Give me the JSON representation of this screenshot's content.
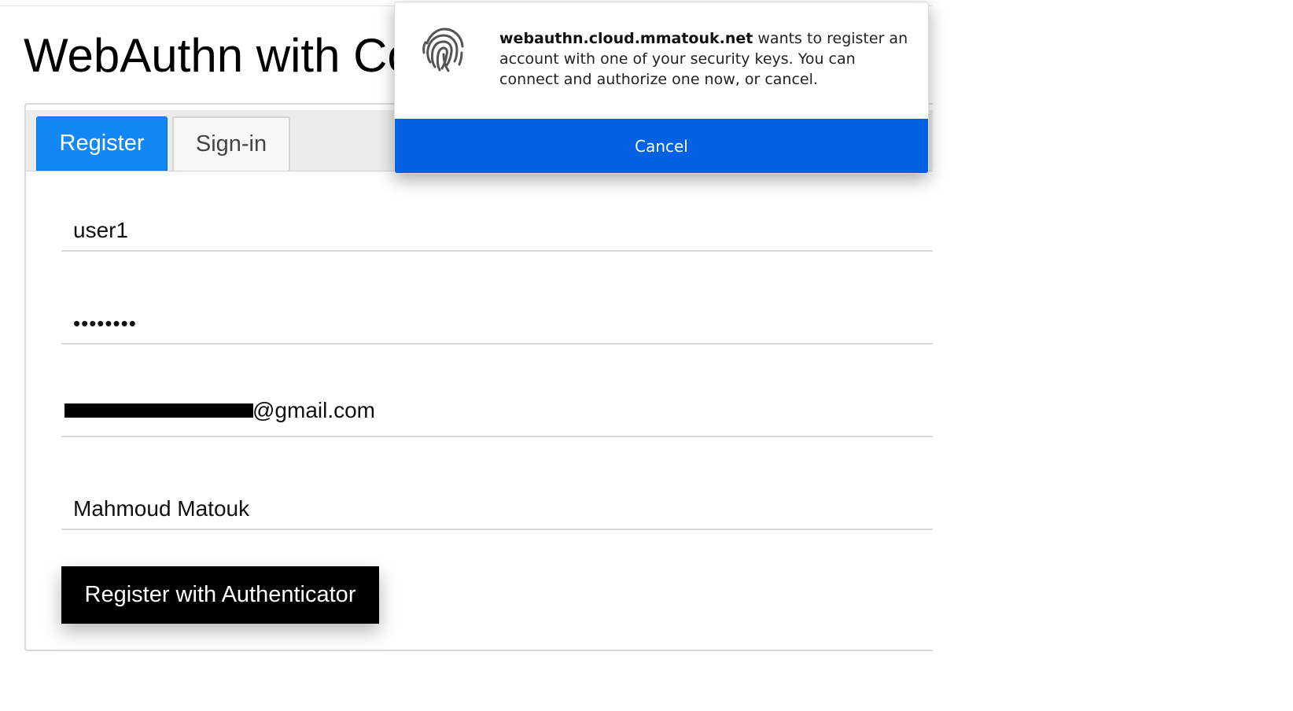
{
  "page": {
    "title": "WebAuthn with Co"
  },
  "tabs": [
    {
      "label": "Register",
      "active": true
    },
    {
      "label": "Sign-in",
      "active": false
    }
  ],
  "form": {
    "username": "user1",
    "password": "••••••••",
    "email_visible_suffix": "@gmail.com",
    "display_name": "Mahmoud Matouk",
    "submit_label": "Register with Authenticator"
  },
  "dialog": {
    "domain": "webauthn.cloud.mmatouk.net",
    "message": " wants to register an account with one of your security keys. You can connect and authorize one now, or cancel.",
    "icon": "fingerprint-icon",
    "cancel_label": "Cancel"
  },
  "colors": {
    "active_tab": "#1387f5",
    "dialog_button": "#0062e3",
    "submit_button": "#000000"
  }
}
